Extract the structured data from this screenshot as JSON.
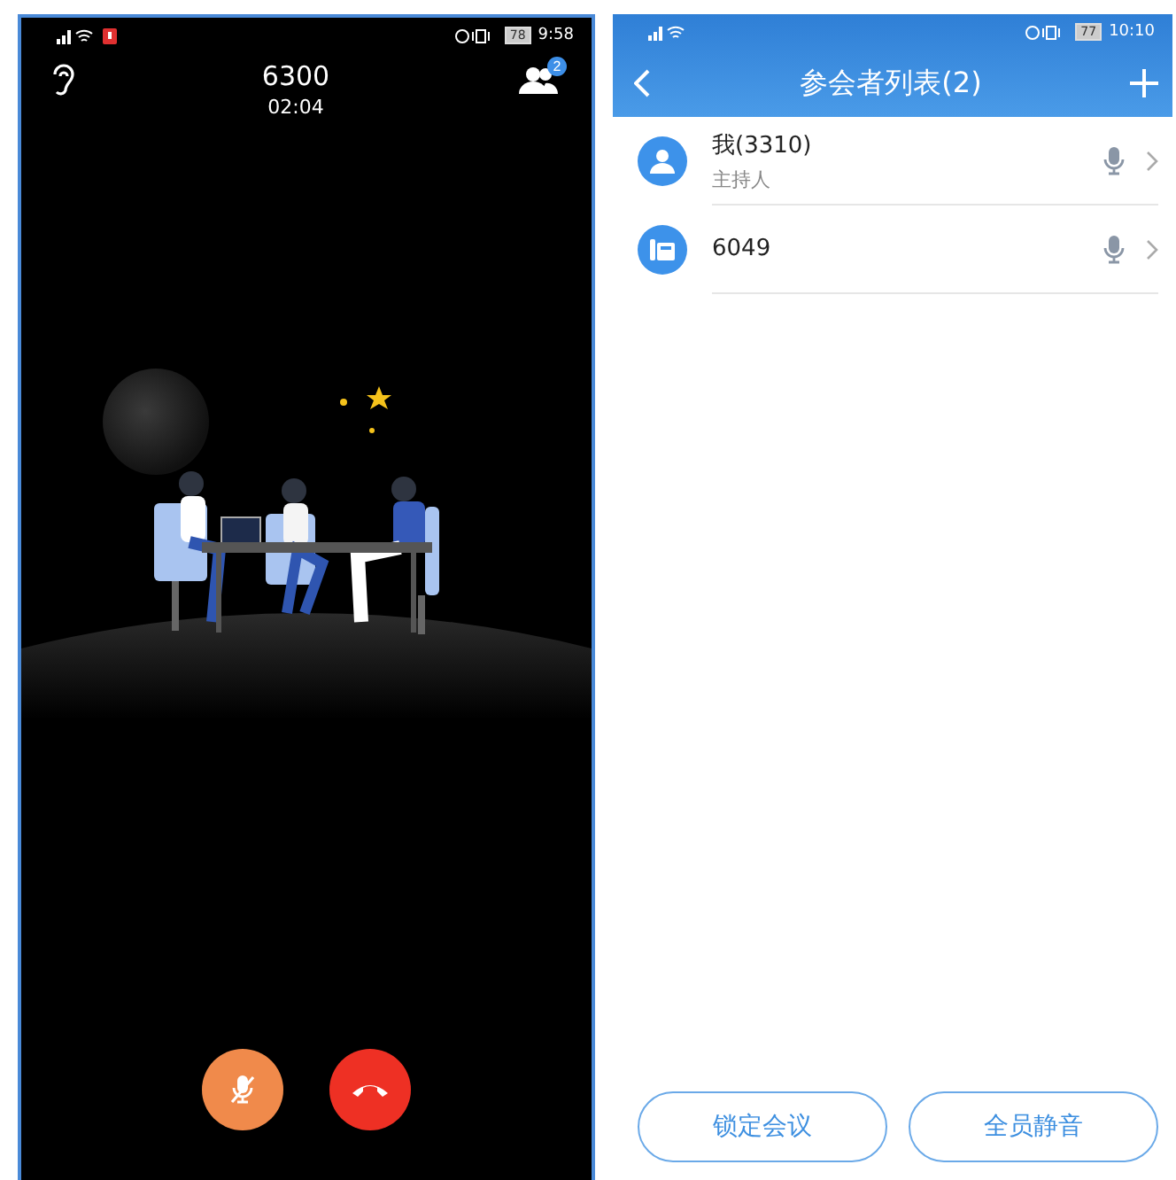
{
  "call_screen": {
    "status_bar": {
      "battery": "78",
      "time": "9:58"
    },
    "number": "6300",
    "duration": "02:04",
    "participants_badge": "2",
    "mic_muted": true
  },
  "participants_screen": {
    "status_bar": {
      "battery": "77",
      "time": "10:10"
    },
    "title": "参会者列表(2)",
    "participants": [
      {
        "kind": "person",
        "name": "我(3310)",
        "role": "主持人",
        "muted": false
      },
      {
        "kind": "phone",
        "name": "6049",
        "muted": false
      }
    ],
    "buttons": [
      "锁定会议",
      "全员静音"
    ]
  }
}
